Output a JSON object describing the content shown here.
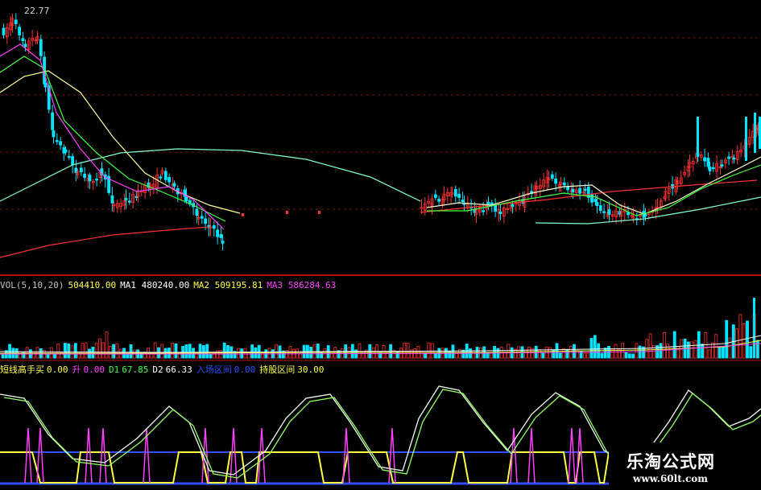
{
  "colors": {
    "background": "#000000",
    "bull": "#ff3030",
    "bear": "#00e5ff",
    "white_line": "#ffffff",
    "yellow": "#ffff40",
    "magenta": "#ff40ff",
    "green": "#40ff40",
    "blue": "#3050ff",
    "separator": "#b01010"
  },
  "kline": {
    "high_label": "22.77"
  },
  "volume": {
    "items": [
      {
        "label": "VOL(5,10,20)",
        "color": "#c0c0c0"
      },
      {
        "label": "504410.00",
        "color": "#ffff40"
      },
      {
        "label": "MA1 480240.00",
        "color": "#ffffff"
      },
      {
        "label": "MA2 509195.81",
        "color": "#ffff40"
      },
      {
        "label": "MA3 586284.63",
        "color": "#ff40ff"
      }
    ]
  },
  "oscillator": {
    "items": [
      {
        "label": "短线高手买",
        "value": "0.00",
        "color": "#ffff40"
      },
      {
        "label": "升",
        "value": "0.00",
        "color": "#ff40ff"
      },
      {
        "label": "D1",
        "value": "67.85",
        "color": "#40ff40"
      },
      {
        "label": "D2",
        "value": "66.33",
        "color": "#ffffff"
      },
      {
        "label": "入场区间",
        "value": "0.00",
        "color": "#3050ff"
      },
      {
        "label": "持股区间",
        "value": "30.00",
        "color": "#ffff40"
      }
    ]
  },
  "watermark": {
    "title": "乐淘公式网",
    "url": "www.60lt.com"
  }
}
